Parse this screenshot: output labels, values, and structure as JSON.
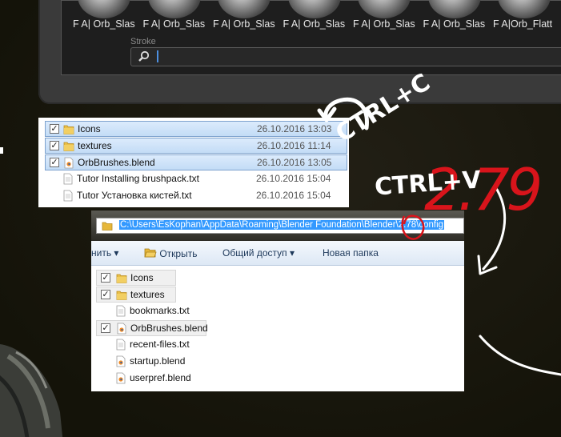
{
  "blender": {
    "brushes": [
      "F A| Orb_Slas",
      "F A| Orb_Slas",
      "F A| Orb_Slas",
      "F A| Orb_Slas",
      "F A| Orb_Slas",
      "F A| Orb_Slas",
      "F A|Orb_Flatt"
    ],
    "section_label": "Stroke",
    "search_icon": "magnifier-icon"
  },
  "explorer1": {
    "rows": [
      {
        "name": "Icons",
        "date": "26.10.2016 13:03",
        "type": "folder",
        "selected": true
      },
      {
        "name": "textures",
        "date": "26.10.2016 11:14",
        "type": "folder",
        "selected": true
      },
      {
        "name": "OrbBrushes.blend",
        "date": "26.10.2016 13:05",
        "type": "blend",
        "selected": true
      },
      {
        "name": "Tutor Installing brushpack.txt",
        "date": "26.10.2016 15:04",
        "type": "txt",
        "selected": false
      },
      {
        "name": "Tutor Установка кистей.txt",
        "date": "26.10.2016 15:04",
        "type": "txt",
        "selected": false
      }
    ]
  },
  "explorer2": {
    "path": "C:\\Users\\EsKophan\\AppData\\Roaming\\Blender Foundation\\Blender\\2.78\\config",
    "toolbar": {
      "organize": "нить",
      "open": "Открыть",
      "share": "Общий доступ",
      "new_folder": "Новая папка"
    },
    "rows": [
      {
        "name": "Icons",
        "type": "folder",
        "checked": true
      },
      {
        "name": "textures",
        "type": "folder",
        "checked": true
      },
      {
        "name": "bookmarks.txt",
        "type": "txt",
        "checked": false
      },
      {
        "name": "OrbBrushes.blend",
        "type": "blend",
        "checked": true
      },
      {
        "name": "recent-files.txt",
        "type": "txt",
        "checked": false
      },
      {
        "name": "startup.blend",
        "type": "blend",
        "checked": false
      },
      {
        "name": "userpref.blend",
        "type": "blend",
        "checked": false
      }
    ]
  },
  "annotations": {
    "copy": "CTRL+C",
    "paste": "CTRL+V",
    "version_note": "2.79",
    "colors": {
      "handwriting": "#ffffff",
      "version_note": "#d8141b"
    }
  }
}
